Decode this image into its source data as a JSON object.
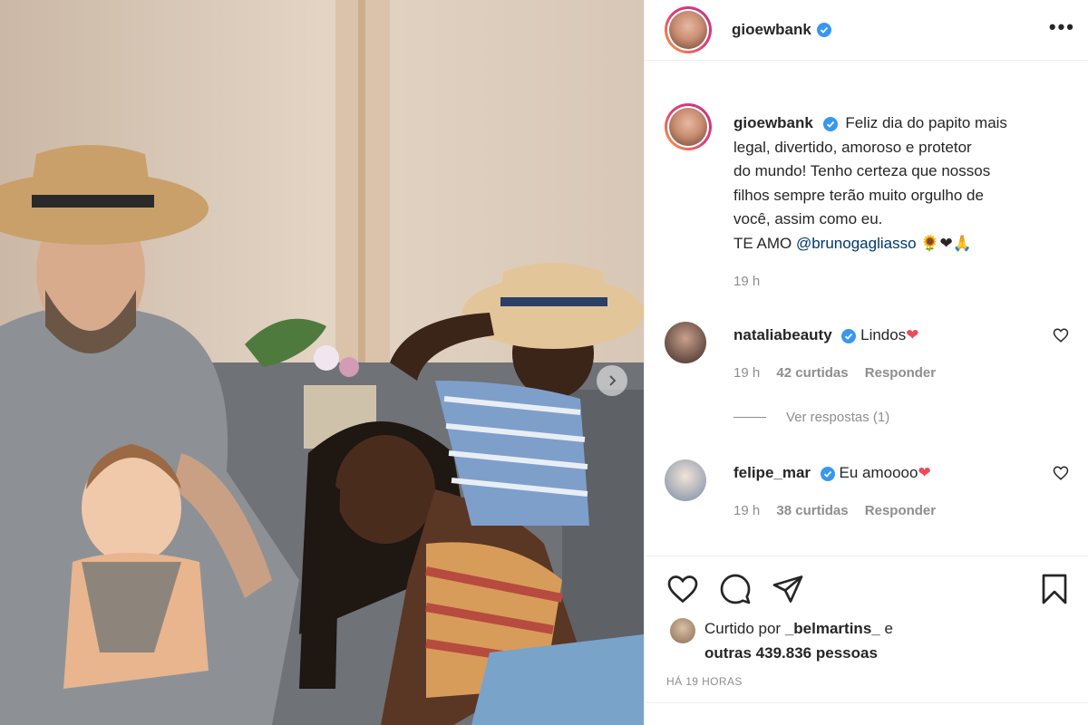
{
  "post": {
    "username": "gioewbank",
    "caption_lines": [
      "Feliz dia do papito mais",
      "legal, divertido, amoroso e protetor",
      "do mundo! Tenho certeza que nossos",
      "filhos sempre terão muito orgulho de",
      "você, assim como eu."
    ],
    "caption_last_prefix": "TE AMO",
    "caption_mention": "@brunogagliasso",
    "caption_emojis": "🌻❤🙏",
    "caption_time": "19 h",
    "more_label": "•••"
  },
  "comments": [
    {
      "username": "nataliabeauty",
      "text": "Lindos",
      "emoji": "❤",
      "time": "19 h",
      "likes": "42 curtidas",
      "reply": "Responder"
    },
    {
      "username": "felipe_mar",
      "text": "Eu amoooo",
      "emoji": "❤",
      "time": "19 h",
      "likes": "38 curtidas",
      "reply": "Responder"
    }
  ],
  "view_replies": "Ver respostas (1)",
  "likes_block": {
    "prefix": "Curtido por",
    "user": "_belmartins_",
    "conj": "e",
    "others": "outras 439.836 pessoas"
  },
  "posted_ago": "HÁ 19 HORAS",
  "colors": {
    "verified": "#3897f0",
    "heart": "#ed4956",
    "muted": "#8e8e8e",
    "mention": "#00376b"
  },
  "icons": [
    "heart-icon",
    "comment-icon",
    "share-icon",
    "bookmark-icon",
    "verified-icon",
    "more-icon",
    "chevron-right-icon"
  ]
}
